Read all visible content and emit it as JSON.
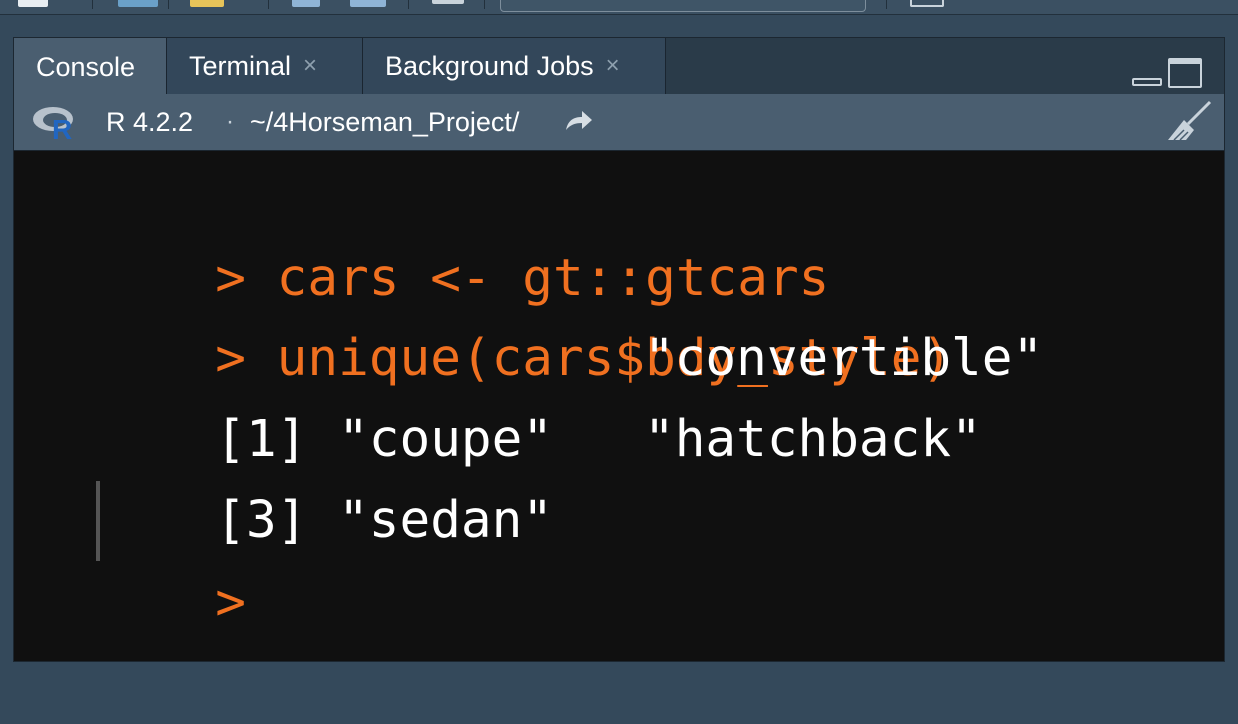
{
  "tabs": [
    {
      "label": "Console",
      "active": true,
      "closable": false
    },
    {
      "label": "Terminal",
      "active": false,
      "closable": true,
      "close_glyph": "×"
    },
    {
      "label": "Background Jobs",
      "active": false,
      "closable": true,
      "close_glyph": "×"
    }
  ],
  "pathbar": {
    "r_version": "R 4.2.2",
    "separator": "·",
    "working_dir": "~/4Horseman_Project/"
  },
  "console": {
    "lines": [
      {
        "type": "input",
        "prompt": ">",
        "text": "cars <- gt::gtcars"
      },
      {
        "type": "input",
        "prompt": ">",
        "text": "unique(cars$bdy_style)"
      },
      {
        "type": "output",
        "index": "[1]",
        "values": [
          "\"coupe\"",
          "\"convertible\""
        ]
      },
      {
        "type": "output",
        "index": "[3]",
        "values": [
          "\"sedan\"",
          "\"hatchback\""
        ]
      },
      {
        "type": "prompt",
        "prompt": ">"
      }
    ]
  },
  "colors": {
    "prompt": "#f07020",
    "output": "#ffffff",
    "background": "#101010",
    "tab_bar": "#2a3b49",
    "tab_active": "#4a5e70",
    "r_logo_blue": "#2166c1"
  },
  "icons": {
    "r_logo": "r-logo-icon",
    "goto_dir": "arrow-forward-icon",
    "clear_console": "broom-icon",
    "minimize": "minimize-icon",
    "maximize": "maximize-icon"
  }
}
